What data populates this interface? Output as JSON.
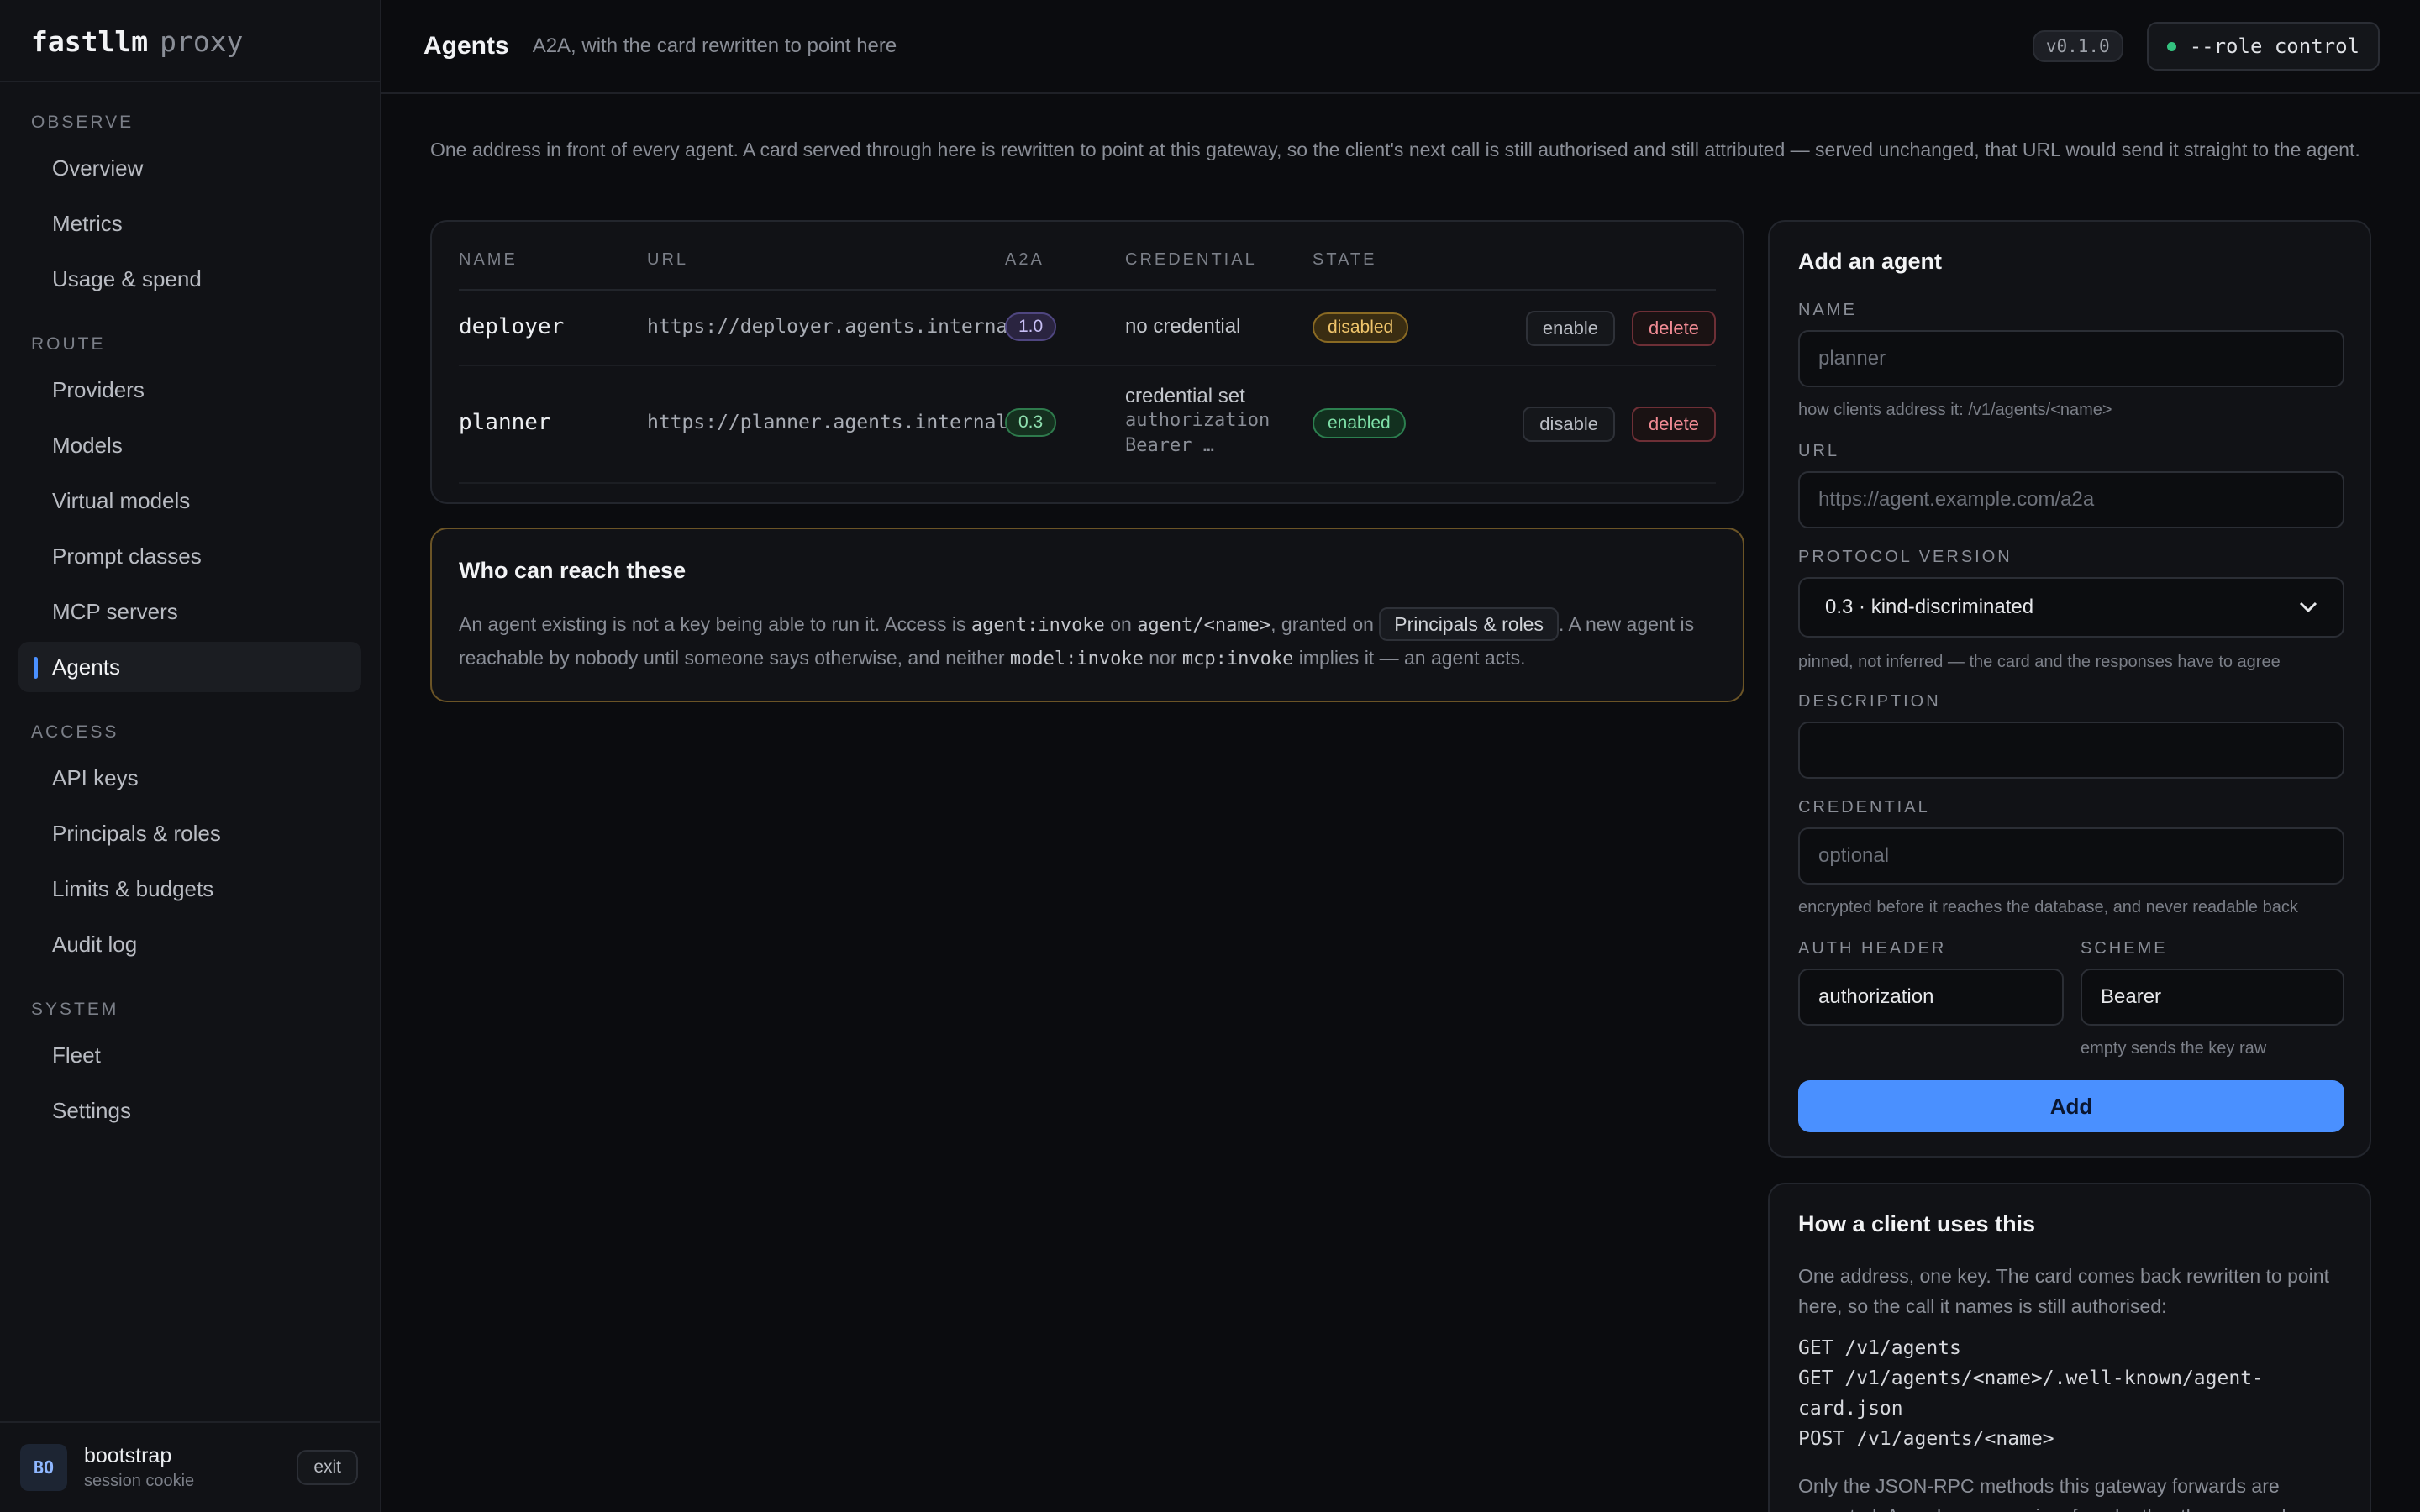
{
  "brand": {
    "name": "fastllm",
    "suffix": "proxy"
  },
  "sidebar": {
    "sections": [
      {
        "title": "OBSERVE",
        "items": [
          {
            "label": "Overview"
          },
          {
            "label": "Metrics"
          },
          {
            "label": "Usage & spend"
          }
        ]
      },
      {
        "title": "ROUTE",
        "items": [
          {
            "label": "Providers"
          },
          {
            "label": "Models"
          },
          {
            "label": "Virtual models"
          },
          {
            "label": "Prompt classes"
          },
          {
            "label": "MCP servers"
          },
          {
            "label": "Agents"
          }
        ]
      },
      {
        "title": "ACCESS",
        "items": [
          {
            "label": "API keys"
          },
          {
            "label": "Principals & roles"
          },
          {
            "label": "Limits & budgets"
          },
          {
            "label": "Audit log"
          }
        ]
      },
      {
        "title": "SYSTEM",
        "items": [
          {
            "label": "Fleet"
          },
          {
            "label": "Settings"
          }
        ]
      }
    ],
    "active": "Agents",
    "user": {
      "initials": "BO",
      "name": "bootstrap",
      "subtitle": "session cookie",
      "exit_label": "exit"
    }
  },
  "header": {
    "title": "Agents",
    "subtitle": "A2A, with the card rewritten to point here",
    "version": "v0.1.0",
    "role_label": "--role control",
    "role_status_color": "#33c27f"
  },
  "intro": "One address in front of every agent. A card served through here is rewritten to point at this gateway, so the client's next call is still authorised and still attributed — served unchanged, that URL would send it straight to the agent.",
  "agents_table": {
    "columns": {
      "name": "NAME",
      "url": "URL",
      "a2a": "A2A",
      "credential": "CREDENTIAL",
      "state": "STATE"
    },
    "rows": [
      {
        "name": "deployer",
        "url": "https://deployer.agents.internal",
        "a2a": "1.0",
        "credential": "no credential",
        "credential_header": "",
        "credential_scheme": "",
        "state": "disabled",
        "toggle_label": "enable",
        "delete_label": "delete"
      },
      {
        "name": "planner",
        "url": "https://planner.agents.internal/",
        "a2a": "0.3",
        "credential": "credential set",
        "credential_header": "authorization",
        "credential_scheme": "Bearer …",
        "state": "enabled",
        "toggle_label": "disable",
        "delete_label": "delete"
      }
    ]
  },
  "who": {
    "title": "Who can reach these",
    "p1": "An agent existing is not a key being able to run it. Access is ",
    "code1": "agent:invoke",
    "p2": " on ",
    "code2": "agent/<name>",
    "p3": ", granted on ",
    "link": "Principals & roles",
    "p4": ". A new agent is reachable by nobody until someone says otherwise, and neither ",
    "code3": "model:invoke",
    "p5": " nor ",
    "code4": "mcp:invoke",
    "p6": " implies it — an agent acts."
  },
  "add_form": {
    "title": "Add an agent",
    "name_label": "NAME",
    "name_placeholder": "planner",
    "name_hint": "how clients address it: /v1/agents/<name>",
    "url_label": "URL",
    "url_placeholder": "https://agent.example.com/a2a",
    "protocol_label": "PROTOCOL VERSION",
    "protocol_value": "0.3 · kind-discriminated",
    "protocol_hint": "pinned, not inferred — the card and the responses have to agree",
    "description_label": "DESCRIPTION",
    "description_value": "",
    "credential_label": "CREDENTIAL",
    "credential_placeholder": "optional",
    "credential_hint": "encrypted before it reaches the database, and never readable back",
    "auth_header_label": "AUTH HEADER",
    "auth_header_value": "authorization",
    "scheme_label": "SCHEME",
    "scheme_value": "Bearer",
    "scheme_hint": "empty sends the key raw",
    "submit_label": "Add"
  },
  "how": {
    "title": "How a client uses this",
    "p1": "One address, one key. The card comes back rewritten to point here, so the call it names is still authorised:",
    "endpoints": [
      "GET /v1/agents",
      "GET /v1/agents/<name>/.well-known/agent-card.json",
      "POST /v1/agents/<name>"
    ],
    "p2": "Only the JSON-RPC methods this gateway forwards are accepted. An unknown one is refused rather than passed through blind, on a credential the caller never sees."
  },
  "colors": {
    "accent": "#4a90ff",
    "warning_border": "#6b5426",
    "enabled": "#7fe0a8",
    "disabled": "#f0c56b",
    "danger": "#f08a93"
  }
}
